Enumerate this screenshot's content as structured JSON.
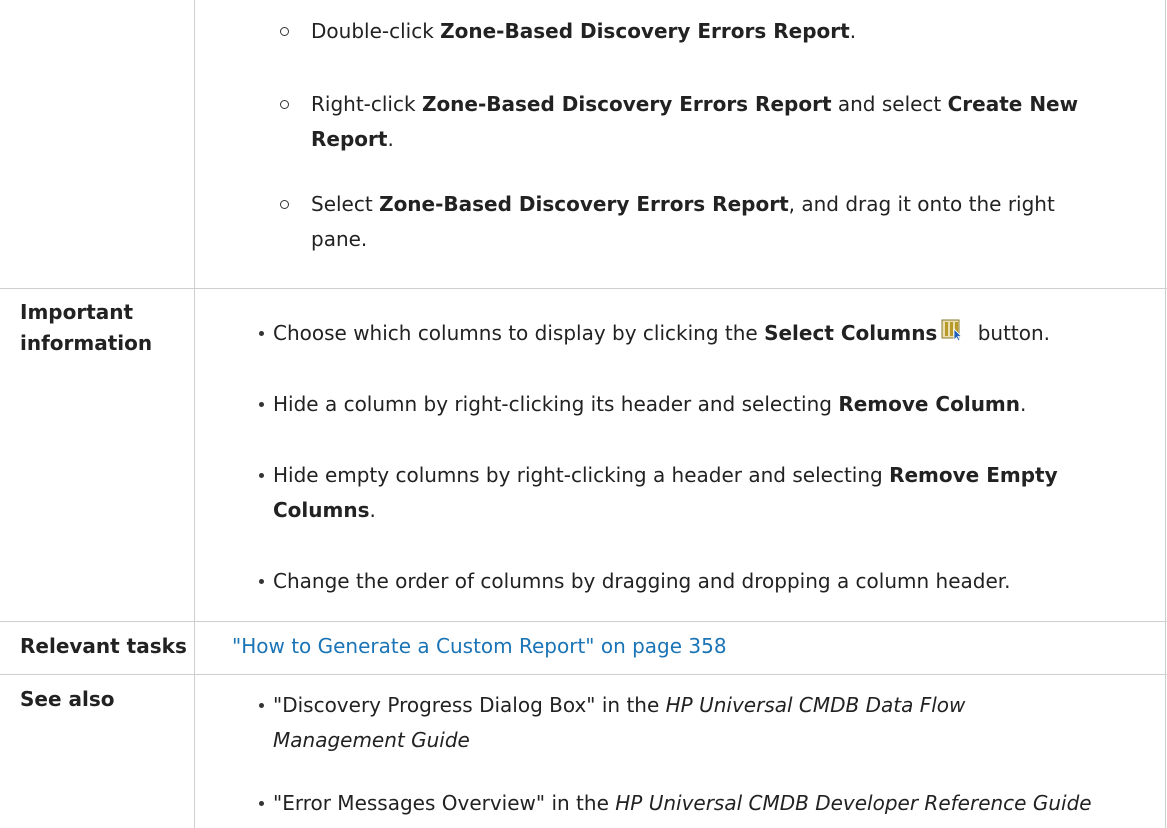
{
  "steps": [
    {
      "pre": "Double-click ",
      "bold": "Zone-Based Discovery Errors Report",
      "post": "."
    },
    {
      "pre": "Right-click ",
      "bold": "Zone-Based Discovery Errors Report",
      "mid": " and select ",
      "bold2": "Create New",
      "line2_bold": "Report",
      "line2_post": "."
    },
    {
      "pre": "Select ",
      "bold": "Zone-Based Discovery Errors Report",
      "post": ", and drag it onto the right",
      "line2": "pane."
    }
  ],
  "important": {
    "label_line1": "Important",
    "label_line2": "information",
    "items": [
      {
        "pre": "Choose which columns to display by clicking the ",
        "bold": "Select Columns",
        "post": " button.",
        "icon": "select-columns-icon"
      },
      {
        "pre": "Hide a column by right-clicking its header and selecting ",
        "bold": "Remove Column",
        "post": "."
      },
      {
        "pre": "Hide empty columns by right-clicking a header and selecting ",
        "bold": "Remove Empty",
        "line2_bold": "Columns",
        "line2_post": "."
      },
      {
        "pre": "Change the order of columns by dragging and dropping a column header."
      }
    ]
  },
  "relevant": {
    "label": "Relevant tasks",
    "link": "\"How to Generate a Custom Report\" on page 358"
  },
  "see_also": {
    "label": "See also",
    "items": [
      {
        "pre": "\"Discovery Progress Dialog Box\" in the ",
        "ital": "HP Universal CMDB Data Flow",
        "line2_ital": "Management Guide"
      },
      {
        "pre": "\"Error Messages Overview\" in the ",
        "ital": "HP Universal CMDB Developer Reference Guide"
      }
    ]
  },
  "colors": {
    "link": "#1a74b5",
    "border": "#cfcfcf",
    "text": "#222222"
  }
}
